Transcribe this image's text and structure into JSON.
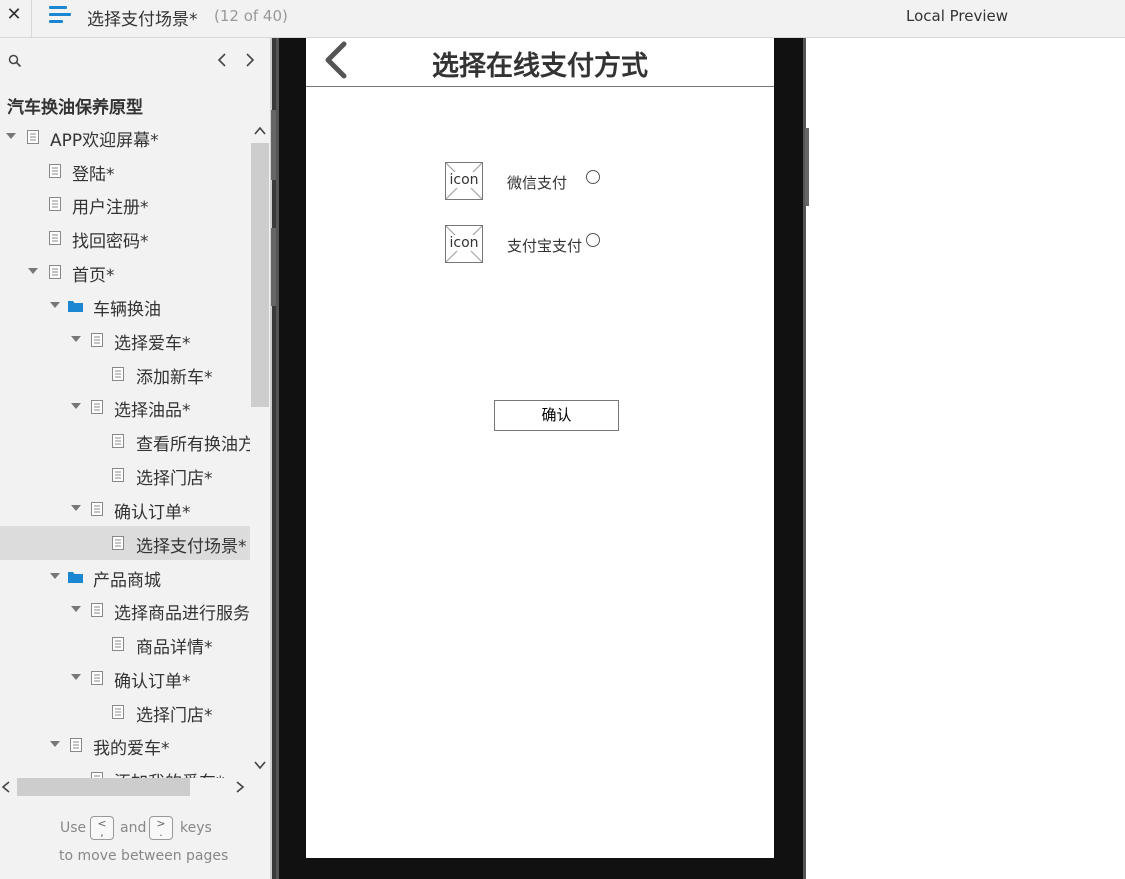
{
  "topbar": {
    "close_glyph": "✕",
    "page_name": "选择支付场景*",
    "page_count": "(12 of 40)",
    "preview_label": "Local Preview",
    "menu_color": "#1b86d1"
  },
  "sidebar": {
    "project_title": "汽车换油保养原型",
    "tree": [
      {
        "label": "APP欢迎屏幕*",
        "type": "page",
        "expanded": true
      },
      {
        "label": "登陆*",
        "type": "page"
      },
      {
        "label": "用户注册*",
        "type": "page"
      },
      {
        "label": "找回密码*",
        "type": "page"
      },
      {
        "label": "首页*",
        "type": "page",
        "expanded": true
      },
      {
        "label": "车辆换油",
        "type": "folder",
        "expanded": true
      },
      {
        "label": "选择爱车*",
        "type": "page",
        "expanded": true
      },
      {
        "label": "添加新车*",
        "type": "page"
      },
      {
        "label": "选择油品*",
        "type": "page",
        "expanded": true
      },
      {
        "label": "查看所有换油方",
        "type": "page"
      },
      {
        "label": "选择门店*",
        "type": "page"
      },
      {
        "label": "确认订单*",
        "type": "page",
        "expanded": true
      },
      {
        "label": "选择支付场景*",
        "type": "page",
        "selected": true
      },
      {
        "label": "产品商城",
        "type": "folder",
        "expanded": true
      },
      {
        "label": "选择商品进行服务",
        "type": "page",
        "expanded": true
      },
      {
        "label": "商品详情*",
        "type": "page"
      },
      {
        "label": "确认订单*",
        "type": "page",
        "expanded": true
      },
      {
        "label": "选择门店*",
        "type": "page"
      },
      {
        "label": "我的爱车*",
        "type": "page",
        "expanded": true
      },
      {
        "label": "添加我的爱车*",
        "type": "page"
      }
    ],
    "hint": {
      "use": "Use",
      "and": "and",
      "keys": "keys",
      "prev_key": "<\n,",
      "next_key": ">\n.",
      "line2": "to move between pages"
    },
    "folder_color": "#1b86d1"
  },
  "screen": {
    "title": "选择在线支付方式",
    "payment_options": [
      {
        "icon_text": "icon",
        "label": "微信支付"
      },
      {
        "icon_text": "icon",
        "label": "支付宝支付"
      }
    ],
    "confirm_label": "确认"
  }
}
